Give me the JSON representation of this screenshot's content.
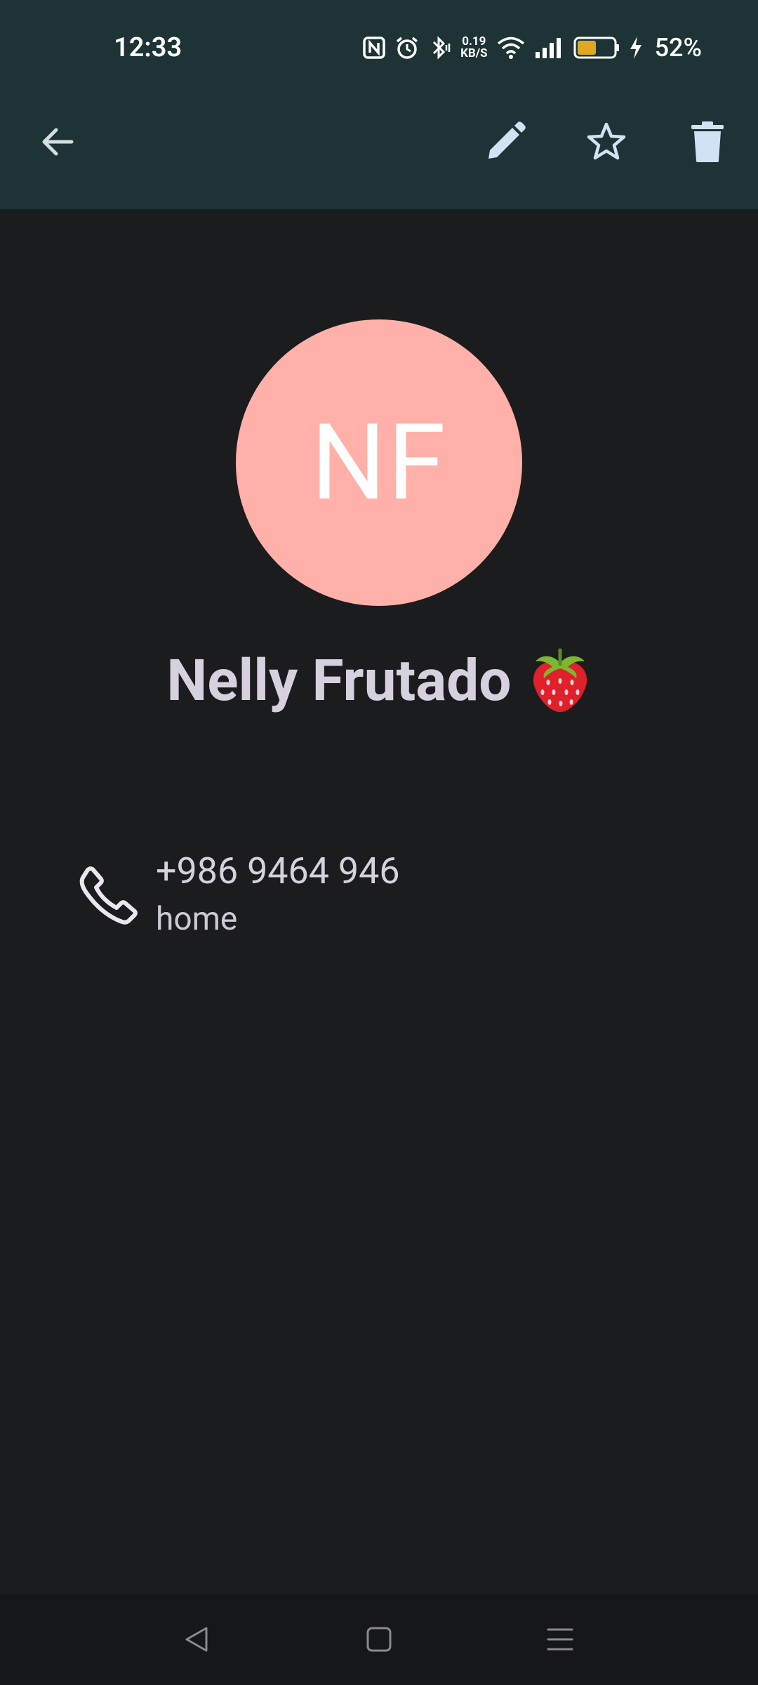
{
  "status_bar": {
    "time": "12:33",
    "net_speed_value": "0.19",
    "net_speed_unit": "KB/S",
    "battery_percent": "52%",
    "battery_level": 0.52,
    "icons": [
      "nfc-icon",
      "alarm-icon",
      "bluetooth-icon",
      "wifi-icon",
      "signal-icon",
      "battery-icon",
      "charging-icon"
    ]
  },
  "toolbar": {
    "icons": [
      "back-arrow-icon",
      "edit-icon",
      "star-icon",
      "delete-icon"
    ]
  },
  "contact": {
    "initials": "NF",
    "name": "Nelly Frutado",
    "emoji": "strawberry",
    "avatar_color": "#ffb0a8",
    "phone": {
      "number": "+986 9464 946",
      "type": "home"
    }
  },
  "colors": {
    "appbar": "#1d3335",
    "background": "#1a1c1e",
    "text": "#d7d0de",
    "battery_fill": "#e0a820"
  },
  "nav_bar": {
    "icons": [
      "nav-back-icon",
      "nav-home-icon",
      "nav-recents-icon"
    ]
  }
}
